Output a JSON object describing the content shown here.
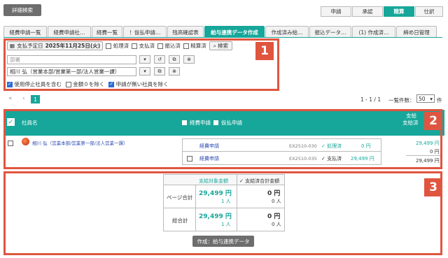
{
  "top": {
    "detail_search": "詳細検索",
    "modes": [
      "申請",
      "承認",
      "精算",
      "仕訳"
    ],
    "active_mode": "精算"
  },
  "tabs": [
    "経費申請一覧",
    "経費申請社…",
    "経費一覧",
    "！仮払申請…",
    "残高確認表",
    "給与連携データ作成",
    "作成済み給…",
    "振込データ…",
    "(1) 作成済…",
    "締め日管理"
  ],
  "filters": {
    "pay_date_label": "支払予定日",
    "pay_date_value": "2025年11月25日(火)",
    "status_checks": [
      "処理済",
      "支払済",
      "振込済",
      "精算済"
    ],
    "search_label": "検索",
    "dept_placeholder": "部署",
    "employee_value": "相川 弘（営業本部/営業第一部/法人営業一課）",
    "bottom_checks": [
      {
        "label": "使用停止社員を含む",
        "checked": true
      },
      {
        "label": "金額０を除く",
        "checked": false
      },
      {
        "label": "申請が無い社員を除く",
        "checked": true
      }
    ]
  },
  "pager": {
    "first": "«",
    "prev": "‹",
    "current": "1",
    "range": "1 - 1 / 1",
    "per_page_label": "一覧件数：",
    "per_page_value": "50",
    "per_page_unit": "件"
  },
  "table": {
    "col_employee": "社員名",
    "col_expense": "経費申請",
    "col_advance": "仮払申請",
    "col_pay1": "支給",
    "col_pay2": "支給済",
    "row": {
      "employee": "相川 弘（営業本部/営業第一部/法人営業一課）",
      "items": [
        {
          "type": "経費申請",
          "code": "EX2510-030",
          "status": "✓ 処理済",
          "amount": "0 円"
        },
        {
          "type": "経費申請",
          "code": "EX2510-035",
          "status": "✓ 支払済",
          "amount": "29,499 円"
        }
      ],
      "totals": [
        "29,499 円",
        "0 円",
        "29,499 円"
      ]
    }
  },
  "summary": {
    "col_target": "支給対象金額",
    "col_paid": "✓ 支給済合計金額",
    "rows": [
      {
        "label": "ページ合計",
        "target_amount": "29,499 円",
        "target_people": "1 人",
        "paid_amount": "0 円",
        "paid_people": "0 人"
      },
      {
        "label": "総合計",
        "target_amount": "29,499 円",
        "target_people": "1 人",
        "paid_amount": "0 円",
        "paid_people": "0 人"
      }
    ],
    "create_button": "作成：給与連携データ"
  },
  "badges": [
    "1",
    "2",
    "3"
  ],
  "colors": {
    "accent": "#17a79a",
    "highlight": "#e0553f",
    "header_dark": "#6d6d6d"
  }
}
